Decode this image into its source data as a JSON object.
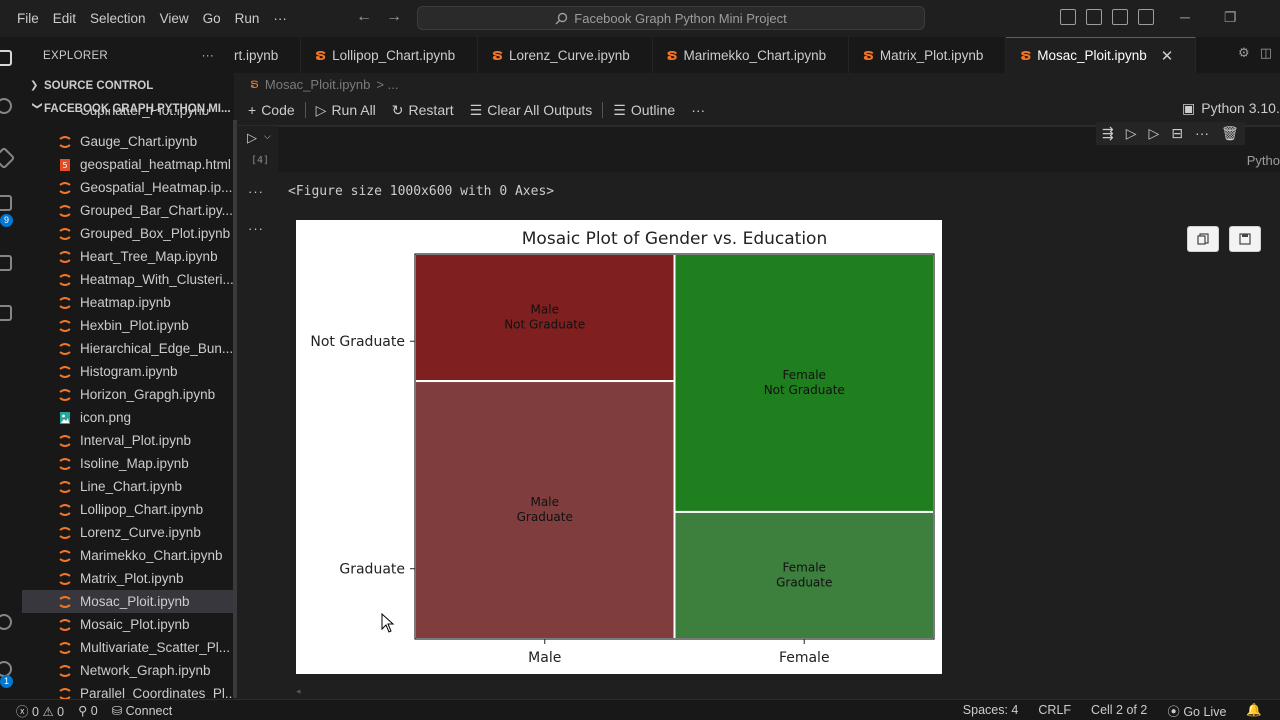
{
  "menu": [
    "File",
    "Edit",
    "Selection",
    "View",
    "Go",
    "Run",
    "···"
  ],
  "search": {
    "text": "Facebook Graph Python Mini Project"
  },
  "sidebar": {
    "title": "EXPLORER",
    "more": "···",
    "source_control": "SOURCE CONTROL",
    "project": "FACEBOOK GRAPH PYTHON MI...",
    "partial_top": "Cupinatter_Plot.ipynb",
    "files": [
      {
        "name": "Gauge_Chart.ipynb",
        "type": "notebook"
      },
      {
        "name": "geospatial_heatmap.html",
        "type": "html"
      },
      {
        "name": "Geospatial_Heatmap.ip...",
        "type": "notebook"
      },
      {
        "name": "Grouped_Bar_Chart.ipy...",
        "type": "notebook"
      },
      {
        "name": "Grouped_Box_Plot.ipynb",
        "type": "notebook"
      },
      {
        "name": "Heart_Tree_Map.ipynb",
        "type": "notebook"
      },
      {
        "name": "Heatmap_With_Clusteri...",
        "type": "notebook"
      },
      {
        "name": "Heatmap.ipynb",
        "type": "notebook"
      },
      {
        "name": "Hexbin_Plot.ipynb",
        "type": "notebook"
      },
      {
        "name": "Hierarchical_Edge_Bun...",
        "type": "notebook"
      },
      {
        "name": "Histogram.ipynb",
        "type": "notebook"
      },
      {
        "name": "Horizon_Grapgh.ipynb",
        "type": "notebook"
      },
      {
        "name": "icon.png",
        "type": "image"
      },
      {
        "name": "Interval_Plot.ipynb",
        "type": "notebook"
      },
      {
        "name": "Isoline_Map.ipynb",
        "type": "notebook"
      },
      {
        "name": "Line_Chart.ipynb",
        "type": "notebook"
      },
      {
        "name": "Lollipop_Chart.ipynb",
        "type": "notebook"
      },
      {
        "name": "Lorenz_Curve.ipynb",
        "type": "notebook"
      },
      {
        "name": "Marimekko_Chart.ipynb",
        "type": "notebook"
      },
      {
        "name": "Matrix_Plot.ipynb",
        "type": "notebook"
      },
      {
        "name": "Mosac_Ploit.ipynb",
        "type": "notebook",
        "active": true
      },
      {
        "name": "Mosaic_Plot.ipynb",
        "type": "notebook"
      },
      {
        "name": "Multivariate_Scatter_Pl...",
        "type": "notebook"
      },
      {
        "name": "Network_Graph.ipynb",
        "type": "notebook"
      },
      {
        "name": "Parallel_Coordinates_Pl...",
        "type": "notebook"
      }
    ]
  },
  "activity_badges": [
    "9",
    "1"
  ],
  "tabs": [
    {
      "label": "rt.ipynb",
      "partial": true
    },
    {
      "label": "Lollipop_Chart.ipynb"
    },
    {
      "label": "Lorenz_Curve.ipynb"
    },
    {
      "label": "Marimekko_Chart.ipynb"
    },
    {
      "label": "Matrix_Plot.ipynb"
    },
    {
      "label": "Mosac_Ploit.ipynb",
      "active": true,
      "close": "✕"
    }
  ],
  "breadcrumb": {
    "file": "Mosac_Ploit.ipynb",
    "rest": "> ..."
  },
  "toolbar": {
    "code": "Code",
    "run_all": "Run All",
    "restart": "Restart",
    "clear": "Clear All Outputs",
    "outline": "Outline",
    "more": "···",
    "kernel": "Python 3.10.",
    "kernel_short": "Pytho"
  },
  "cell": {
    "exec_count": "[4]",
    "output_text": "<Figure size 1000x600 with 0 Axes>"
  },
  "chart_data": {
    "type": "mosaic",
    "title": "Mosaic Plot of Gender vs. Education",
    "categories": [
      "Male",
      "Female"
    ],
    "y_categories": [
      "Not Graduate",
      "Graduate"
    ],
    "column_widths": [
      0.5,
      0.5
    ],
    "segments": [
      {
        "x": "Male",
        "y": "Graduate",
        "fraction": 0.67,
        "label": "Male\nGraduate",
        "color": "#7f3d3d"
      },
      {
        "x": "Male",
        "y": "Not Graduate",
        "fraction": 0.33,
        "label": "Male\nNot Graduate",
        "color": "#7f1f1f"
      },
      {
        "x": "Female",
        "y": "Graduate",
        "fraction": 0.33,
        "label": "Female\nGraduate",
        "color": "#3d7f3d"
      },
      {
        "x": "Female",
        "y": "Not Graduate",
        "fraction": 0.67,
        "label": "Female\nNot Graduate",
        "color": "#1f7f1f"
      }
    ],
    "y_tick_positions": [
      0.333,
      0.833
    ]
  },
  "statusbar": {
    "errors": "0",
    "warnings": "0",
    "ports": "0",
    "connect": "Connect",
    "spaces": "Spaces: 4",
    "eol": "CRLF",
    "cell": "Cell 2 of 2",
    "golive": "Go Live"
  },
  "colors": {
    "accent": "#0078d4",
    "jupyter": "#f37626"
  }
}
